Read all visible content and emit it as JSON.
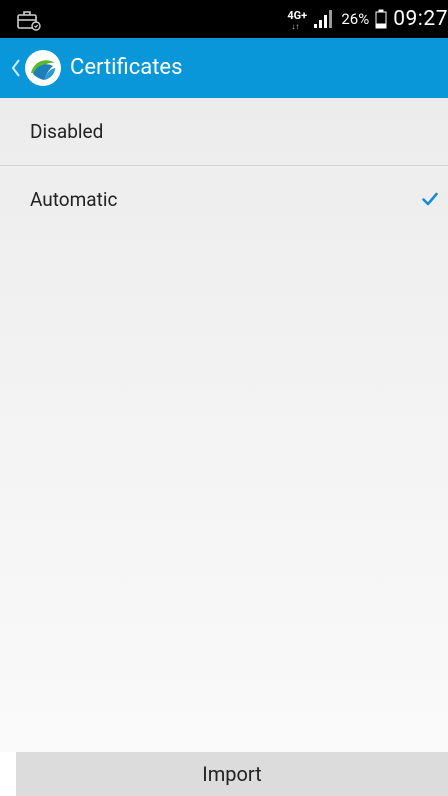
{
  "status_bar": {
    "network_type": "4G+",
    "network_arrows": "↓↑",
    "battery_percent": "26%",
    "time": "09:27",
    "left_icon": "briefcase-notification-icon",
    "signal_icon": "signal-strength-icon",
    "battery_icon": "battery-icon"
  },
  "app_bar": {
    "title": "Certificates",
    "back_icon": "back-chevron-icon",
    "logo_icon": "app-logo-icon",
    "background_color": "#0a97d9"
  },
  "list": {
    "items": [
      {
        "label": "Disabled",
        "selected": false
      },
      {
        "label": "Automatic",
        "selected": true
      }
    ],
    "check_icon": "checkmark-icon",
    "check_color": "#1a8ccf"
  },
  "bottom": {
    "import_label": "Import"
  }
}
